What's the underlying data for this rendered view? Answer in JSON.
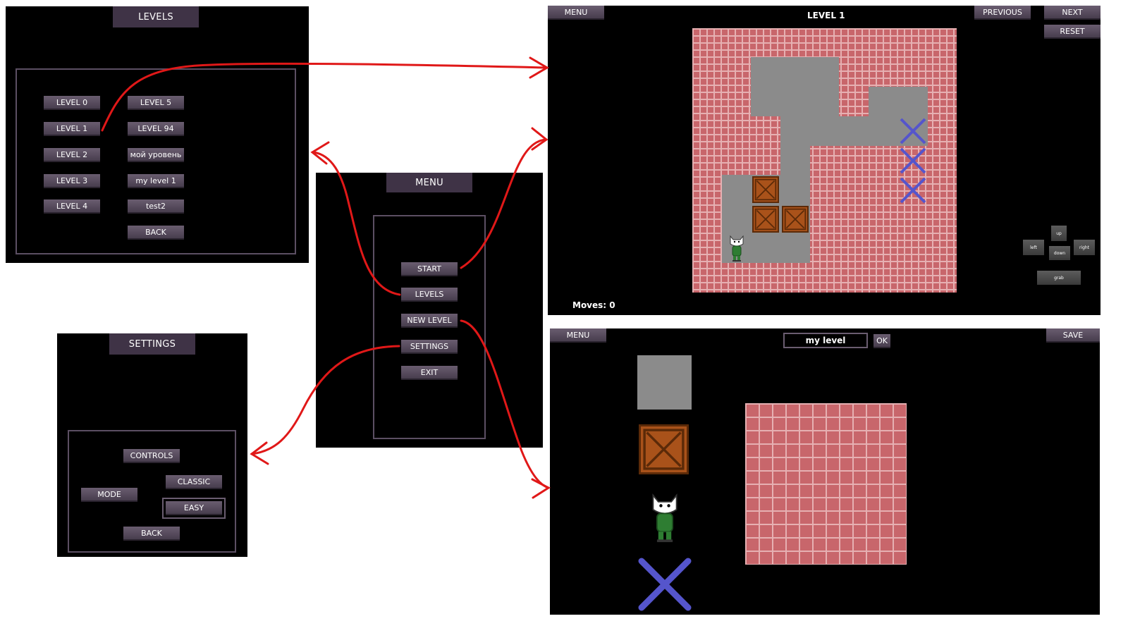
{
  "levels_screen": {
    "title": "LEVELS",
    "left_column": [
      "LEVEL 0",
      "LEVEL 1",
      "LEVEL 2",
      "LEVEL 3",
      "LEVEL 4"
    ],
    "right_column": [
      "LEVEL 5",
      "LEVEL 94",
      "мой уровень",
      "my level 1",
      "test2"
    ],
    "back": "BACK"
  },
  "menu_screen": {
    "title": "MENU",
    "items": [
      "START",
      "LEVELS",
      "NEW LEVEL",
      "SETTINGS",
      "EXIT"
    ]
  },
  "settings_screen": {
    "title": "SETTINGS",
    "controls": "CONTROLS",
    "mode": "MODE",
    "classic": "CLASSIC",
    "easy": "EASY",
    "back": "BACK"
  },
  "game_screen": {
    "menu": "MENU",
    "title": "LEVEL 1",
    "previous": "PREVIOUS",
    "next": "NEXT",
    "reset": "RESET",
    "moves": "Moves: 0",
    "pad": {
      "up": "up",
      "left": "left",
      "down": "down",
      "right": "right",
      "grab": "grab"
    }
  },
  "editor_screen": {
    "menu": "MENU",
    "level_name": "my level",
    "ok": "OK",
    "save": "SAVE"
  },
  "colors": {
    "panel_bg": "#000000",
    "button": "#5a4e60",
    "brick": "#c8666b",
    "floor": "#8b8b8b",
    "crate": "#a9521a",
    "target": "#5555cc",
    "arrow": "#e01818"
  }
}
